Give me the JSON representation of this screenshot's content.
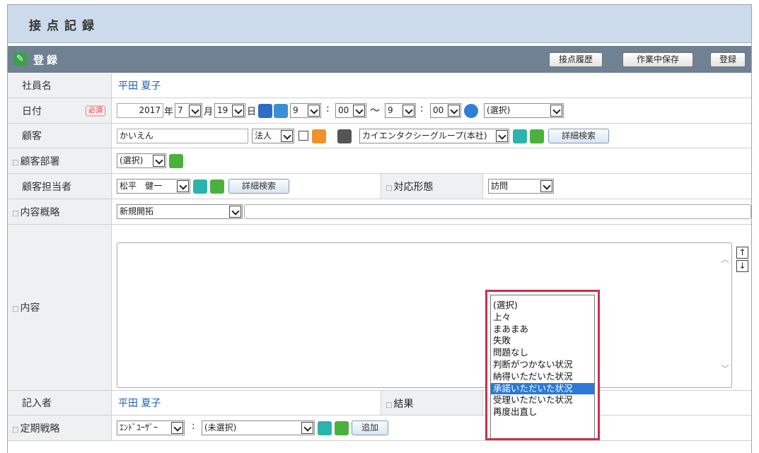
{
  "window": {
    "title": "接点記録"
  },
  "section": {
    "title": "登録",
    "buttons": {
      "history": "接点履歴",
      "draft": "作業中保存",
      "register": "登録"
    }
  },
  "labels": {
    "employee": "社員名",
    "date": "日付",
    "required": "必須",
    "customer": "顧客",
    "customer_dept": "顧客部署",
    "customer_contact": "顧客担当者",
    "response_type": "対応形態",
    "summary": "内容概略",
    "content": "内容",
    "author": "記入者",
    "result": "結果",
    "strategy": "定期戦略",
    "collapse_mark": "□"
  },
  "employee_name": "平田 夏子",
  "date": {
    "year": "2017",
    "year_unit": "年",
    "month": "7",
    "month_unit": "月",
    "day": "19",
    "day_unit": "日",
    "hour_start": "9",
    "colon": ":",
    "min_start": "00",
    "tilde": "～",
    "hour_end": "9",
    "min_end": "00",
    "select": "(選択)"
  },
  "customer": {
    "search_text": "かいえん",
    "type": "法人",
    "company": "カイエンタクシーグループ(本社)",
    "detail_search": "詳細検索"
  },
  "customer_dept": {
    "select": "(選択)"
  },
  "customer_contact": {
    "name": "松平　健一",
    "detail_search": "詳細検索",
    "response_type": "訪問"
  },
  "summary": {
    "select": "新規開拓",
    "text": ""
  },
  "content": {
    "text": ""
  },
  "author_name": "平田 夏子",
  "strategy": {
    "user_select": "ｴﾝﾄﾞﾕｰｻﾞｰ",
    "colon": ":",
    "value": "(未選択)",
    "add": "追加"
  },
  "result_dropdown": {
    "options": [
      "(選択)",
      "上々",
      "まあまあ",
      "失敗",
      "問題なし",
      "判断がつかない状況",
      "納得いただいた状況",
      "承諾いただいた状況",
      "受理いただいた状況",
      "再度出直し"
    ],
    "highlighted_index": 7
  },
  "colors": {
    "accent": "#c8314d",
    "highlight": "#2a79d6",
    "header_bar": "#6f8193",
    "title_bar": "#ccdbeb"
  }
}
